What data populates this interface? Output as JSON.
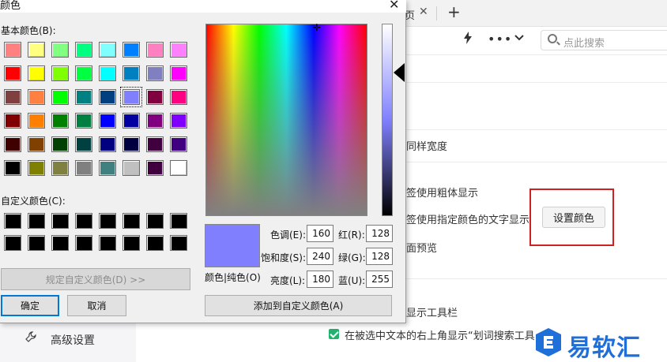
{
  "background": {
    "tab_label": "页",
    "tab_close": "✕",
    "tab_new": "+",
    "toolbar": {
      "flash_icon": "lightning-icon",
      "more": "•••",
      "chevron": "⌄"
    },
    "search": {
      "placeholder": "点此搜索"
    },
    "rows": [
      {
        "text": "同样宽度"
      },
      {
        "text": "签使用粗体显示"
      },
      {
        "text": "签使用指定颜色的文字显示"
      },
      {
        "text": "面预览"
      },
      {
        "text": "显示工具栏"
      }
    ],
    "set_color_button": "设置颜色",
    "advanced_settings": "高级设置",
    "checkbox_text": "在被选中文本的右上角显示“划词搜索工具",
    "watermark_text": "易软汇",
    "highlight_color": "#cc2222"
  },
  "dialog": {
    "title": "颜色",
    "basic_colors_label": "基本颜色(B):",
    "custom_colors_label": "自定义颜色(C):",
    "basic_colors": [
      [
        "#ff8080",
        "#ffff80",
        "#80ff80",
        "#00ff80",
        "#80ffff",
        "#0080ff",
        "#ff80c0",
        "#ff80ff"
      ],
      [
        "#ff0000",
        "#ffff00",
        "#80ff00",
        "#00ff40",
        "#00ffff",
        "#0080c0",
        "#8080c0",
        "#ff00ff"
      ],
      [
        "#804040",
        "#ff8040",
        "#00ff00",
        "#008080",
        "#004080",
        "#8080ff",
        "#800040",
        "#ff0080"
      ],
      [
        "#800000",
        "#ff8000",
        "#008000",
        "#008040",
        "#0000ff",
        "#0000a0",
        "#800080",
        "#8000ff"
      ],
      [
        "#400000",
        "#804000",
        "#004000",
        "#004040",
        "#000080",
        "#000040",
        "#400040",
        "#400080"
      ],
      [
        "#000000",
        "#808000",
        "#808040",
        "#808080",
        "#408080",
        "#c0c0c0",
        "#400040",
        "#ffffff"
      ]
    ],
    "selected_swatch": {
      "row": 2,
      "col": 5
    },
    "custom_colors": [
      "#000000",
      "#000000",
      "#000000",
      "#000000",
      "#000000",
      "#000000",
      "#000000",
      "#000000",
      "#000000",
      "#000000",
      "#000000",
      "#000000",
      "#000000",
      "#000000",
      "#000000",
      "#000000"
    ],
    "define_custom_button": "规定自定义颜色(D) >>",
    "ok_button": "确定",
    "cancel_button": "取消",
    "add_custom_button": "添加到自定义颜色(A)",
    "preview_label": "颜色|纯色(O)",
    "preview_color": "#8080ff",
    "hue_label": "色调(E):",
    "hue_value": "160",
    "sat_label": "饱和度(S):",
    "sat_value": "240",
    "lum_label": "亮度(L):",
    "lum_value": "180",
    "red_label": "红(R):",
    "red_value": "128",
    "green_label": "绿(G):",
    "green_value": "128",
    "blue_label": "蓝(U):",
    "blue_value": "255",
    "close_icon": "✕"
  }
}
